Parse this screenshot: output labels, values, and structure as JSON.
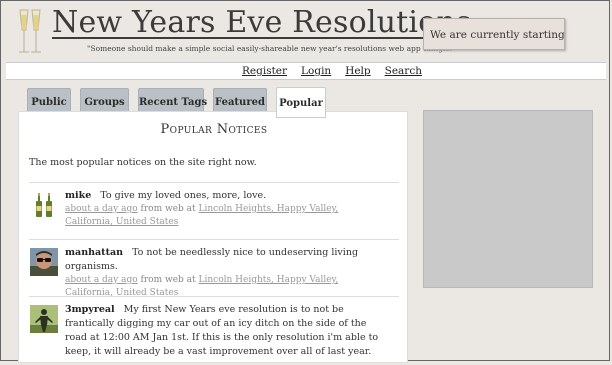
{
  "header": {
    "title": "New Years Eve Resolutions",
    "tagline": "\"Someone should make a simple social easily-shareable new year's resolutions web app thingie.\"",
    "status": "We are currently starting to drink..."
  },
  "nav": {
    "links": [
      "Register",
      "Login",
      "Help",
      "Search"
    ]
  },
  "tabs": [
    {
      "label": "Public",
      "active": false
    },
    {
      "label": "Groups",
      "active": false
    },
    {
      "label": "Recent Tags",
      "active": false
    },
    {
      "label": "Featured",
      "active": false
    },
    {
      "label": "Popular",
      "active": true
    }
  ],
  "main": {
    "section_title": "Popular Notices",
    "description": "The most popular notices on the site right now.",
    "notices": [
      {
        "user": "mike",
        "text": "To give my loved ones, more, love.",
        "time": "about a day ago",
        "from": "from web at",
        "location": "Lincoln Heights, Happy Valley, California, United States"
      },
      {
        "user": "manhattan",
        "text": "To not be needlessly nice to undeserving living organisms.",
        "time": "about a day ago",
        "from": "from web at",
        "location": "Lincoln Heights, Happy Valley, California, United States"
      },
      {
        "user": "3mpyreal",
        "text": "My first New Years eve resolution is to not be frantically digging my car out of an icy ditch on the side of the road at 12:00 AM Jan 1st. If this is the only resolution i'm able to keep, it will already be a vast improvement over all of last year."
      }
    ]
  }
}
